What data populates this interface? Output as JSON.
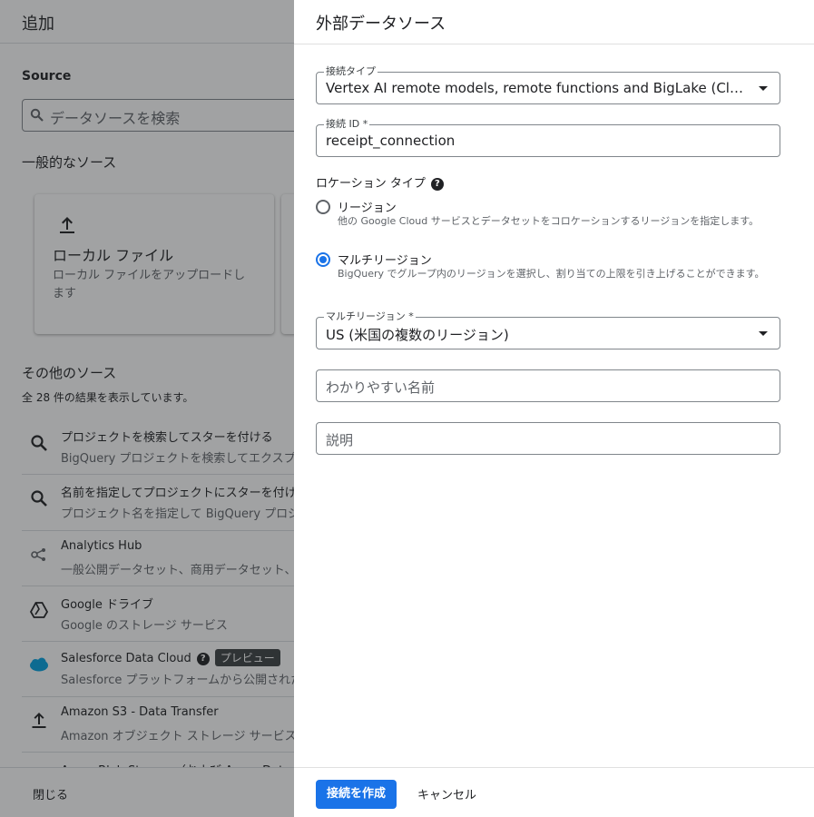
{
  "background": {
    "title": "追加",
    "source_label": "Source",
    "search_placeholder": "データソースを検索",
    "general_sources": "一般的なソース",
    "local_card": {
      "title": "ローカル ファイル",
      "desc": "ローカル ファイルをアップロードします"
    },
    "other_sources": "その他のソース",
    "result_count": "全 28 件の結果を表示しています。",
    "items": [
      {
        "title": "プロジェクトを検索してスターを付ける",
        "desc": "BigQuery プロジェクトを検索してエクスプロ",
        "icon": "search-icon"
      },
      {
        "title": "名前を指定してプロジェクトにスターを付け",
        "desc": "プロジェクト名を指定して BigQuery プロジェ",
        "icon": "search-icon"
      },
      {
        "title": "Analytics Hub",
        "desc": "一般公開データセット、商用データセット、",
        "icon": "analytics-hub-icon"
      },
      {
        "title": "Google ドライブ",
        "desc": "Google のストレージ サービス",
        "icon": "google-drive-icon"
      },
      {
        "title": "Salesforce Data Cloud",
        "desc": "Salesforce プラットフォームから公開された",
        "icon": "salesforce-icon",
        "badge": "プレビュー"
      },
      {
        "title": "Amazon S3 - Data Transfer",
        "desc": "Amazon オブジェクト ストレージ サービス",
        "icon": "upload-icon"
      },
      {
        "title": "Azure Blob Storage（および Azure Data Lake",
        "desc": "",
        "icon": "upload-icon"
      }
    ],
    "close_label": "閉じる"
  },
  "panel": {
    "title": "外部データソース",
    "connection_type": {
      "label": "接続タイプ",
      "value": "Vertex AI remote models, remote functions and BigLake (Cloud Resource)"
    },
    "connection_id": {
      "label": "接続 ID *",
      "value": "receipt_connection"
    },
    "location_type_label": "ロケーション タイプ",
    "radios": [
      {
        "label": "リージョン",
        "desc": "他の Google Cloud サービスとデータセットをコロケーションするリージョンを指定します。",
        "selected": false
      },
      {
        "label": "マルチリージョン",
        "desc": "BigQuery でグループ内のリージョンを選択し、割り当ての上限を引き上げることができます。",
        "selected": true
      }
    ],
    "multi_region": {
      "label": "マルチリージョン *",
      "value": "US (米国の複数のリージョン)"
    },
    "friendly_name_placeholder": "わかりやすい名前",
    "description_placeholder": "説明",
    "create_button": "接続を作成",
    "cancel_button": "キャンセル"
  },
  "colors": {
    "primary": "#1a73e8",
    "scrim": "#202124"
  }
}
